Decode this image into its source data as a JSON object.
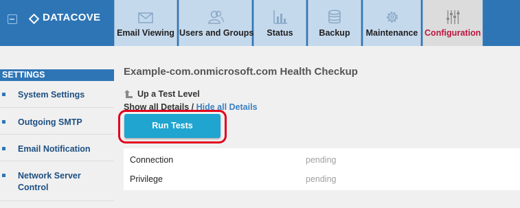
{
  "app": {
    "brand": "DATACOVE"
  },
  "nav": {
    "tabs": [
      {
        "label": "Email Viewing",
        "icon": "envelope-icon"
      },
      {
        "label": "Users and Groups",
        "icon": "users-icon"
      },
      {
        "label": "Status",
        "icon": "bar-chart-icon"
      },
      {
        "label": "Backup",
        "icon": "database-icon"
      },
      {
        "label": "Maintenance",
        "icon": "gear-icon"
      },
      {
        "label": "Configuration",
        "icon": "sliders-icon",
        "active": true
      }
    ]
  },
  "sidebar": {
    "header": "SETTINGS",
    "items": [
      {
        "label": "System Settings"
      },
      {
        "label": "Outgoing SMTP"
      },
      {
        "label": "Email Notification"
      },
      {
        "label_line1": "Network Server",
        "label_line2": "Control"
      }
    ]
  },
  "main": {
    "title": "Example-com.onmicrosoft.com Health Checkup",
    "up_level": "Up a Test Level",
    "show_details": "Show all Details",
    "separator": " / ",
    "hide_details": "Hide all Details",
    "run_button": "Run Tests",
    "results": [
      {
        "name": "Connection",
        "status": "pending"
      },
      {
        "name": "Privilege",
        "status": "pending"
      }
    ]
  },
  "colors": {
    "header_blue": "#2e75b6",
    "tab_bg": "#c5d9ed",
    "active_tab_text": "#c0143c",
    "run_button": "#1fa5cf",
    "highlight": "#e0001b",
    "link": "#3a7fc1"
  }
}
